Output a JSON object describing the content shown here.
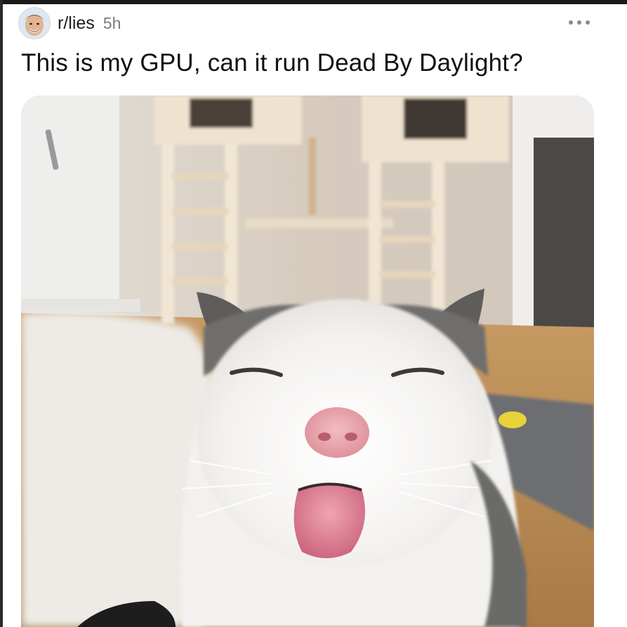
{
  "post": {
    "subreddit": "r/lies",
    "time": "5h",
    "more_icon": "more-horizontal-icon",
    "title": "This is my GPU, can it run Dead By Daylight?"
  },
  "image": {
    "subject": "cat",
    "colors": {
      "wall": "#d8d0c6",
      "floor": "#b88a54",
      "rug": "#ece9e5",
      "cat_white": "#f2f0ee",
      "cat_grey": "#6e6d6c",
      "nose": "#e6a2a8",
      "mouth": "#d56f84"
    }
  }
}
